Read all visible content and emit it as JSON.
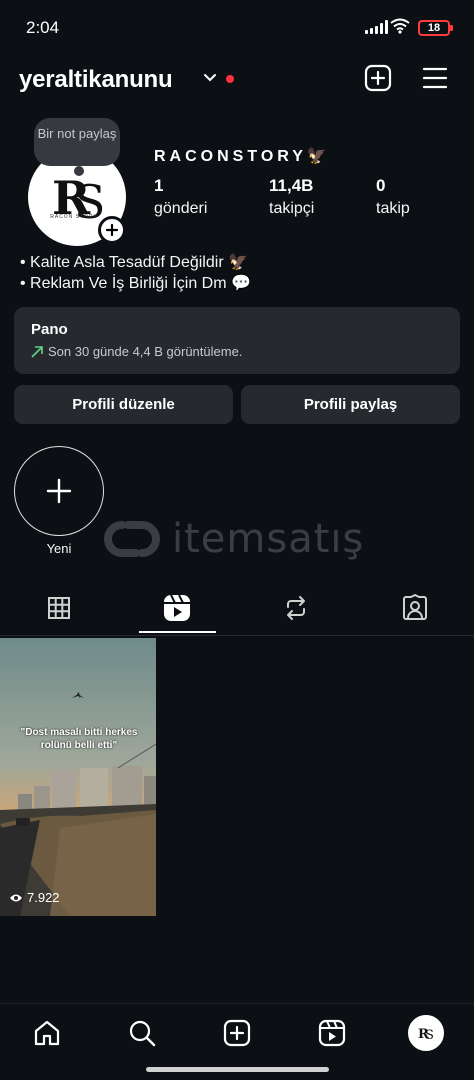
{
  "status_bar": {
    "time": "2:04",
    "battery": "18"
  },
  "header": {
    "username": "yeraltikanunu"
  },
  "profile": {
    "note": "Bir not paylaş",
    "display_name": "RACONSTORY",
    "display_name_emoji": "🦅",
    "stats": [
      {
        "value": "1",
        "label": "gönderi"
      },
      {
        "value": "11,4B",
        "label": "takipçi"
      },
      {
        "value": "0",
        "label": "takip"
      }
    ],
    "bio": [
      "• Kalite Asla Tesadüf Değildir 🦅",
      "• Reklam Ve İş Birliği İçin Dm 💬"
    ],
    "avatar_caption": "RACON STORY"
  },
  "pano": {
    "title": "Pano",
    "subtitle": "Son 30 günde 4,4 B görüntüleme."
  },
  "buttons": {
    "edit": "Profili düzenle",
    "share": "Profili paylaş"
  },
  "highlights": {
    "new_label": "Yeni"
  },
  "watermark": {
    "text": "itemsatış"
  },
  "tabs": [
    "grid-icon",
    "reels-icon",
    "reposts-icon",
    "tagged-icon"
  ],
  "posts": [
    {
      "caption": "\"Dost masalı bitti herkes rolünü belli etti\"",
      "views": "7.922"
    }
  ],
  "nav": [
    "home-icon",
    "search-icon",
    "create-icon",
    "reels-icon",
    "profile-avatar"
  ],
  "colors": {
    "background": "#0c1014",
    "surface": "#262a2f",
    "accent_red": "#ff3040",
    "trend_green": "#5fd38a"
  }
}
